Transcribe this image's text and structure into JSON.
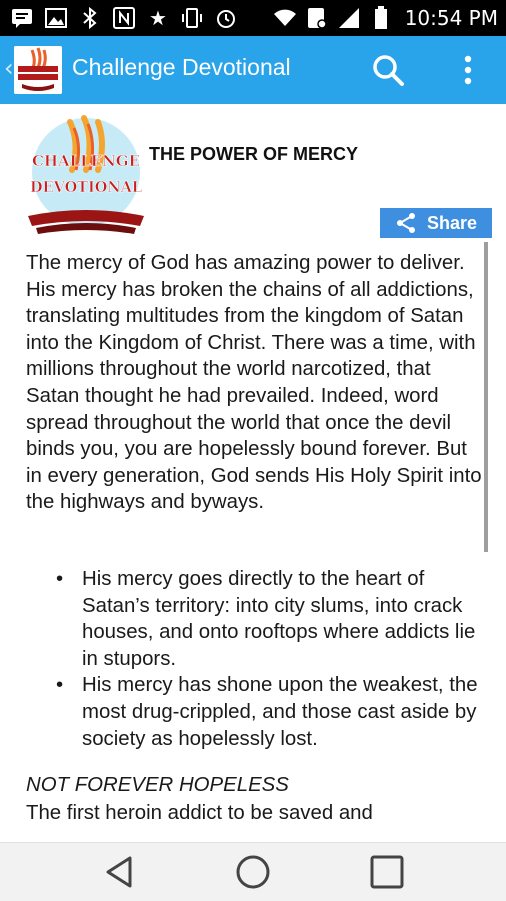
{
  "status_bar": {
    "time": "10:54 PM",
    "icons": [
      "message-icon",
      "image-icon",
      "bluetooth-icon",
      "nfc-icon",
      "star-icon",
      "vibrate-icon",
      "alarm-icon",
      "wifi-icon",
      "data-icon",
      "signal-icon",
      "battery-icon"
    ]
  },
  "app_bar": {
    "title": "Challenge Devotional",
    "logo_text": "CHALLENGE DEVOTIONAL",
    "accent_color": "#29a3ea"
  },
  "article": {
    "logo_lines": [
      "CHALLENGE",
      "DEVOTIONAL"
    ],
    "title": "THE POWER OF MERCY",
    "share_label": "Share",
    "paragraph": "The mercy of God has amazing power to deliver. His mercy has broken the chains of all addictions, translating multitudes from the kingdom of Satan into the Kingdom of Christ. There was a time, with millions throughout the world narcotized, that Satan thought he had prevailed. Indeed, word spread throughout the world that once the devil binds you, you are hopelessly bound forever. But in every generation, God sends His Holy Spirit into the highways and byways.",
    "bullets": [
      "His mercy goes directly to the heart of Satan’s territory: into city slums, into crack houses, and onto rooftops where addicts lie in stupors.",
      "His mercy has shone upon the weakest, the most drug-crippled, and those cast aside by society as hopelessly lost."
    ],
    "subheading": "NOT FOREVER HOPELESS",
    "tail": "The first heroin addict to be saved and"
  },
  "nav_bar": {
    "buttons": [
      "back-icon",
      "home-icon",
      "recents-icon"
    ]
  }
}
